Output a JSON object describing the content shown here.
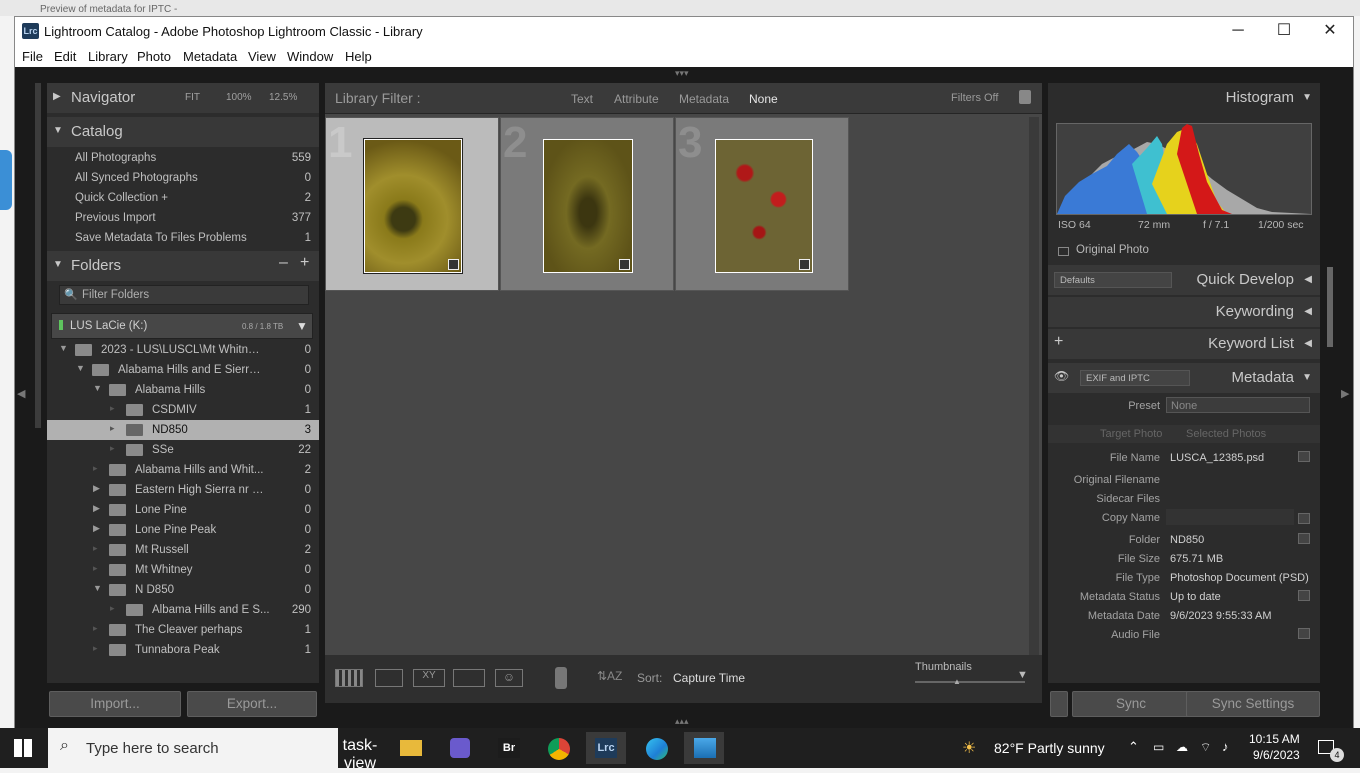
{
  "browser_tab": "Preview of metadata for IPTC -",
  "window": {
    "app_icon": "Lrc",
    "title": "Lightroom Catalog - Adobe Photoshop Lightroom Classic - Library",
    "min": "─",
    "max": "☐",
    "close": "✕"
  },
  "menu": [
    "File",
    "Edit",
    "Library",
    "Photo",
    "Metadata",
    "View",
    "Window",
    "Help"
  ],
  "navigator": {
    "label": "Navigator",
    "fit": "FIT",
    "z1": "100%",
    "z2": "12.5%"
  },
  "catalog": {
    "label": "Catalog",
    "items": [
      {
        "name": "All Photographs",
        "count": "559"
      },
      {
        "name": "All Synced Photographs",
        "count": "0"
      },
      {
        "name": "Quick Collection +",
        "count": "2"
      },
      {
        "name": "Previous Import",
        "count": "377"
      },
      {
        "name": "Save Metadata To Files Problems",
        "count": "1"
      }
    ]
  },
  "folders": {
    "label": "Folders",
    "filter_placeholder": "Filter Folders",
    "volume": "LUS LaCie (K:)",
    "volume_size": "0.8 / 1.8 TB",
    "items": [
      {
        "name": "2023 - LUS\\LUSCL\\Mt Whitney...",
        "count": "0"
      },
      {
        "name": "Alabama Hills and E Sierra ...",
        "count": "0"
      },
      {
        "name": "Alabama Hills",
        "count": "0"
      },
      {
        "name": "CSDMIV",
        "count": "1"
      },
      {
        "name": "ND850",
        "count": "3"
      },
      {
        "name": "SSe",
        "count": "22"
      },
      {
        "name": "Alabama Hills and Whit...",
        "count": "2"
      },
      {
        "name": "Eastern High Sierra nr L...",
        "count": "0"
      },
      {
        "name": "Lone Pine",
        "count": "0"
      },
      {
        "name": "Lone Pine Peak",
        "count": "0"
      },
      {
        "name": "Mt Russell",
        "count": "2"
      },
      {
        "name": "Mt Whitney",
        "count": "0"
      },
      {
        "name": "N D850",
        "count": "0"
      },
      {
        "name": "Albama Hills and E S...",
        "count": "290"
      },
      {
        "name": "The Cleaver perhaps",
        "count": "1"
      },
      {
        "name": "Tunnabora Peak",
        "count": "1"
      }
    ]
  },
  "import_label": "Import...",
  "export_label": "Export...",
  "library_filter": {
    "label": "Library Filter :",
    "text": "Text",
    "attribute": "Attribute",
    "metadata": "Metadata",
    "none": "None",
    "filters_off": "Filters Off"
  },
  "grid": [
    {
      "num": "1"
    },
    {
      "num": "2"
    },
    {
      "num": "3"
    }
  ],
  "toolbar": {
    "sort_label": "Sort:",
    "sort_value": "Capture Time",
    "thumbnails": "Thumbnails"
  },
  "histogram": {
    "label": "Histogram",
    "iso": "ISO 64",
    "focal": "72 mm",
    "aperture": "f / 7.1",
    "shutter": "1/200 sec",
    "original_photo": "Original Photo"
  },
  "quick_develop": {
    "preset": "Defaults",
    "label": "Quick Develop"
  },
  "keywording": "Keywording",
  "keyword_list": "Keyword List",
  "metadata": {
    "set": "EXIF and IPTC",
    "label": "Metadata",
    "preset_key": "Preset",
    "preset_val": "None",
    "target": "Target Photo",
    "selected": "Selected Photos",
    "fields": [
      {
        "k": "File Name",
        "v": "LUSCA_12385.psd"
      },
      {
        "k": "Original Filename",
        "v": ""
      },
      {
        "k": "Sidecar Files",
        "v": ""
      },
      {
        "k": "Copy Name",
        "v": ""
      },
      {
        "k": "Folder",
        "v": "ND850"
      },
      {
        "k": "File Size",
        "v": "675.71 MB"
      },
      {
        "k": "File Type",
        "v": "Photoshop Document (PSD)"
      },
      {
        "k": "Metadata Status",
        "v": "Up to date"
      },
      {
        "k": "Metadata Date",
        "v": "9/6/2023 9:55:33 AM"
      },
      {
        "k": "Audio File",
        "v": ""
      }
    ]
  },
  "sync": "Sync",
  "sync_settings": "Sync Settings",
  "taskbar": {
    "search": "Type here to search",
    "weather": "82°F  Partly sunny",
    "time": "10:15 AM",
    "date": "9/6/2023",
    "notif": "4",
    "apps": [
      "task-view",
      "file-explorer",
      "app-purple",
      "Br",
      "chrome",
      "Lrc",
      "edge",
      "photos"
    ]
  }
}
